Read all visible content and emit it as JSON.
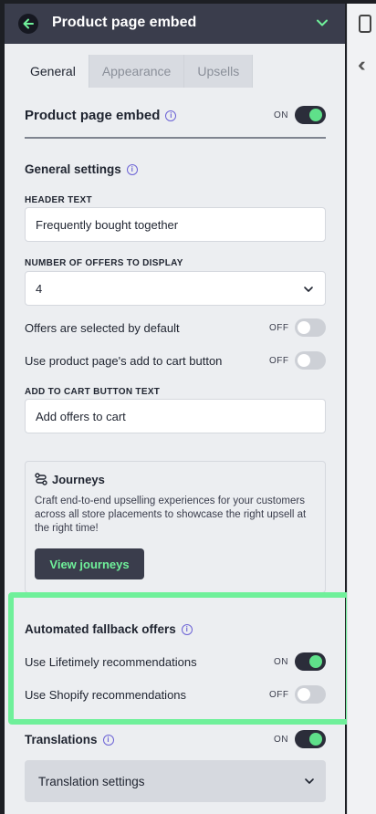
{
  "header": {
    "title": "Product page embed"
  },
  "tabs": [
    {
      "label": "General"
    },
    {
      "label": "Appearance"
    },
    {
      "label": "Upsells"
    }
  ],
  "embed": {
    "title": "Product page embed",
    "state": "ON"
  },
  "general": {
    "title": "General settings",
    "header_text_label": "HEADER TEXT",
    "header_text_value": "Frequently bought together",
    "offers_count_label": "NUMBER OF OFFERS TO DISPLAY",
    "offers_count_value": "4",
    "selected_default_label": "Offers are selected by default",
    "selected_default_state": "OFF",
    "use_product_btn_label": "Use product page's add to cart button",
    "use_product_btn_state": "OFF",
    "add_to_cart_label": "ADD TO CART BUTTON TEXT",
    "add_to_cart_value": "Add offers to cart"
  },
  "journeys": {
    "title": "Journeys",
    "description": "Craft end-to-end upselling experiences for your customers across all store placements to showcase the right upsell at the right time!",
    "button": "View journeys"
  },
  "fallback": {
    "title": "Automated fallback offers",
    "lifetimely_label": "Use Lifetimely recommendations",
    "lifetimely_state": "ON",
    "shopify_label": "Use Shopify recommendations",
    "shopify_state": "OFF"
  },
  "translations": {
    "title": "Translations",
    "state": "ON",
    "settings_label": "Translation settings"
  },
  "colors": {
    "accent_green": "#6ff09a",
    "header_bg": "#3a3d4c",
    "info_purple": "#6c63d6"
  }
}
